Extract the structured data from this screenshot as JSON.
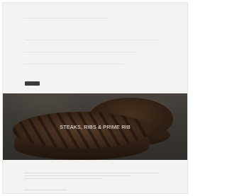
{
  "menu": {
    "items": [
      {
        "name": "",
        "price": ""
      },
      {
        "name": "",
        "price": ""
      },
      {
        "name": "",
        "price": ""
      },
      {
        "name": "",
        "price": ""
      },
      {
        "name": "",
        "price": ""
      },
      {
        "name": "",
        "price": ""
      },
      {
        "name": "",
        "price": ""
      }
    ],
    "more_label": ""
  },
  "hero": {
    "title": "STEAKS, RIBS & PRIME RIB"
  },
  "lower": {
    "item_title": "",
    "sub_item": ""
  }
}
